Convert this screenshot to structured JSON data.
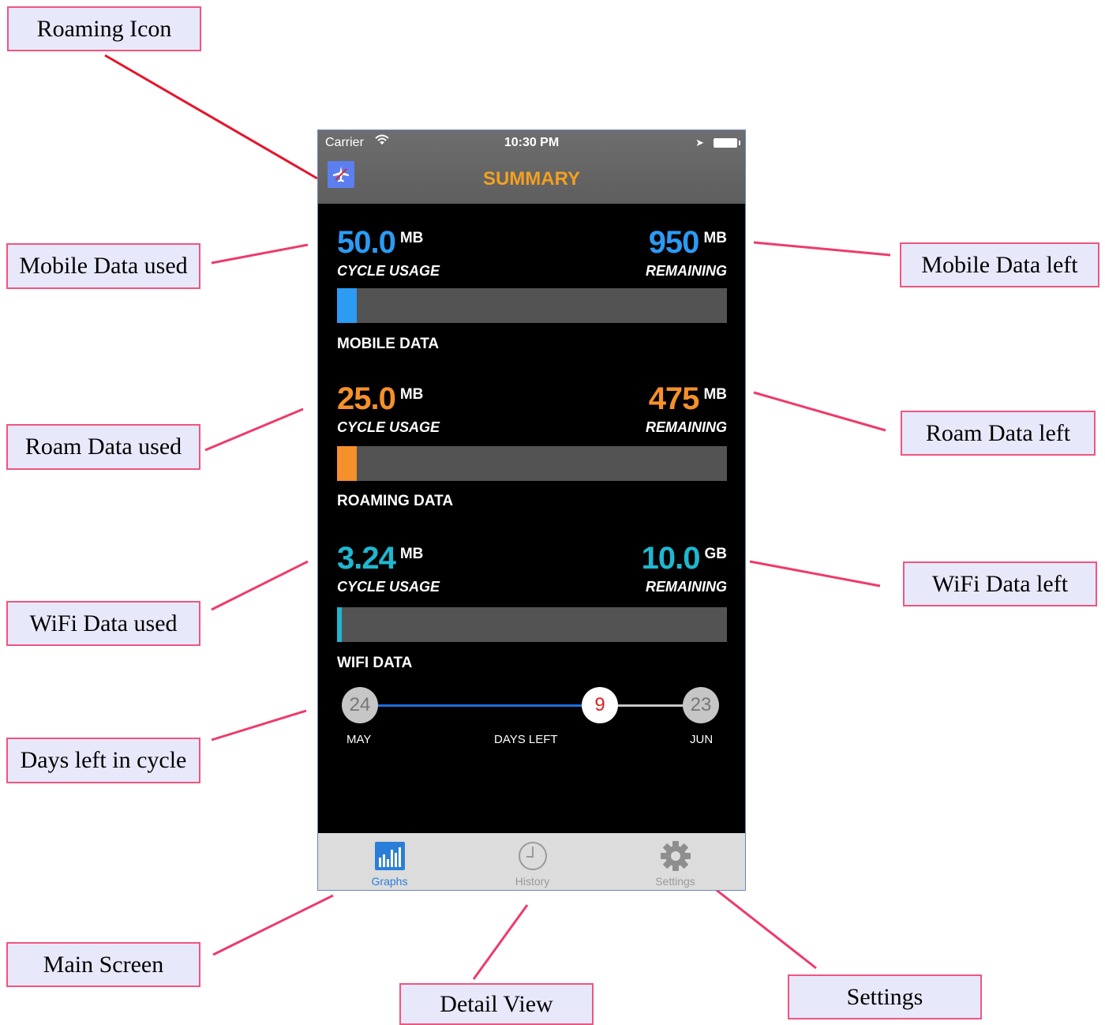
{
  "annotations": {
    "roaming_icon": "Roaming Icon",
    "mobile_used": "Mobile Data used",
    "mobile_left": "Mobile Data left",
    "roam_used": "Roam Data used",
    "roam_left": "Roam Data left",
    "wifi_used": "WiFi Data used",
    "wifi_left": "WiFi Data left",
    "days_left": "Days left in cycle",
    "main_screen": "Main Screen",
    "detail_view": "Detail View",
    "settings": "Settings"
  },
  "status_bar": {
    "carrier": "Carrier",
    "time": "10:30 PM"
  },
  "nav": {
    "title": "SUMMARY"
  },
  "sections": [
    {
      "used_value": "50.0",
      "used_unit": "MB",
      "used_label": "CYCLE USAGE",
      "left_value": "950",
      "left_unit": "MB",
      "left_label": "REMAINING",
      "name": "MOBILE DATA",
      "color": "#2b9bf4",
      "fill_fraction": 0.05
    },
    {
      "used_value": "25.0",
      "used_unit": "MB",
      "used_label": "CYCLE USAGE",
      "left_value": "475",
      "left_unit": "MB",
      "left_label": "REMAINING",
      "name": "ROAMING DATA",
      "color": "#f5902b",
      "fill_fraction": 0.05
    },
    {
      "used_value": "3.24",
      "used_unit": "MB",
      "used_label": "CYCLE USAGE",
      "left_value": "10.0",
      "left_unit": "GB",
      "left_label": "REMAINING",
      "name": "WIFI DATA",
      "color": "#1fb7cf",
      "fill_fraction": 0.01
    }
  ],
  "cycle": {
    "start_day": "24",
    "start_month": "MAY",
    "days_left": "9",
    "days_left_label": "DAYS LEFT",
    "end_day": "23",
    "end_month": "JUN",
    "progress_color": "#1e6fe0"
  },
  "tabs": [
    {
      "label": "Graphs",
      "icon": "bar-graph-icon",
      "active": true
    },
    {
      "label": "History",
      "icon": "clock-icon",
      "active": false
    },
    {
      "label": "Settings",
      "icon": "gear-icon",
      "active": false
    }
  ]
}
